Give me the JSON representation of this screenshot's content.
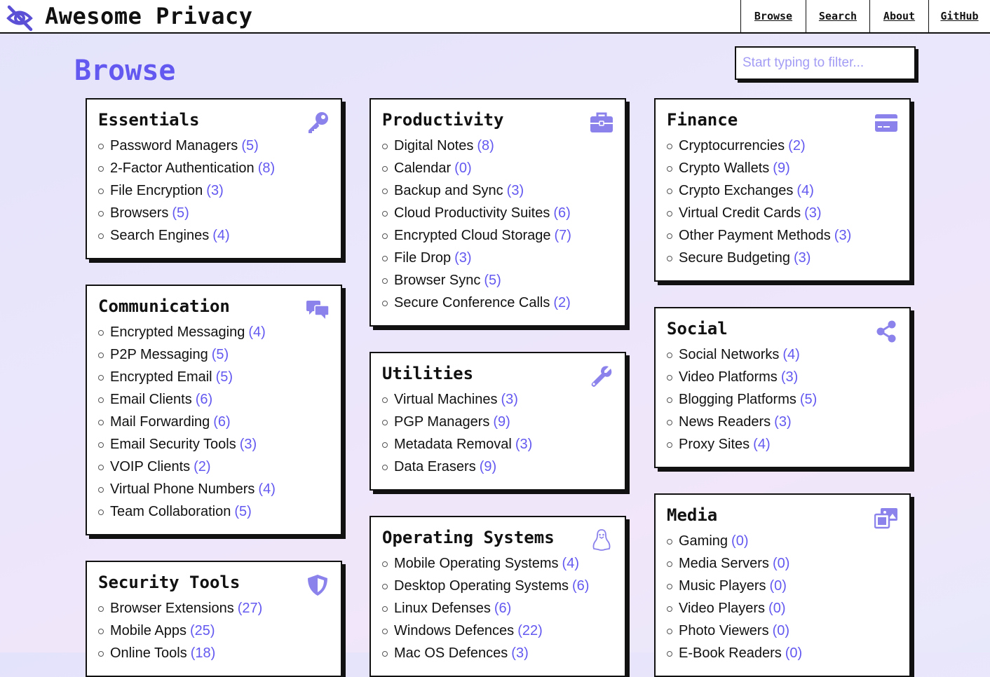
{
  "header": {
    "title": "Awesome Privacy",
    "nav": [
      "Browse",
      "Search",
      "About",
      "GitHub"
    ]
  },
  "page": {
    "title": "Browse",
    "filter_placeholder": "Start typing to filter..."
  },
  "colors": {
    "accent": "#6358f0",
    "icon": "#8b82ec",
    "border": "#111111"
  },
  "categories": [
    {
      "title": "Essentials",
      "icon": "key-icon",
      "items": [
        {
          "name": "Password Managers",
          "count": "(5)"
        },
        {
          "name": "2-Factor Authentication",
          "count": "(8)"
        },
        {
          "name": "File Encryption",
          "count": "(3)"
        },
        {
          "name": "Browsers",
          "count": "(5)"
        },
        {
          "name": "Search Engines",
          "count": "(4)"
        }
      ]
    },
    {
      "title": "Communication",
      "icon": "chat-bubbles-icon",
      "items": [
        {
          "name": "Encrypted Messaging",
          "count": "(4)"
        },
        {
          "name": "P2P Messaging",
          "count": "(5)"
        },
        {
          "name": "Encrypted Email",
          "count": "(5)"
        },
        {
          "name": "Email Clients",
          "count": "(6)"
        },
        {
          "name": "Mail Forwarding",
          "count": "(6)"
        },
        {
          "name": "Email Security Tools",
          "count": "(3)"
        },
        {
          "name": "VOIP Clients",
          "count": "(2)"
        },
        {
          "name": "Virtual Phone Numbers",
          "count": "(4)"
        },
        {
          "name": "Team Collaboration",
          "count": "(5)"
        }
      ]
    },
    {
      "title": "Security Tools",
      "icon": "shield-icon",
      "items": [
        {
          "name": "Browser Extensions",
          "count": "(27)"
        },
        {
          "name": "Mobile Apps",
          "count": "(25)"
        },
        {
          "name": "Online Tools",
          "count": "(18)"
        }
      ]
    },
    {
      "title": "Productivity",
      "icon": "briefcase-icon",
      "items": [
        {
          "name": "Digital Notes",
          "count": "(8)"
        },
        {
          "name": "Calendar",
          "count": "(0)"
        },
        {
          "name": "Backup and Sync",
          "count": "(3)"
        },
        {
          "name": "Cloud Productivity Suites",
          "count": "(6)"
        },
        {
          "name": "Encrypted Cloud Storage",
          "count": "(7)"
        },
        {
          "name": "File Drop",
          "count": "(3)"
        },
        {
          "name": "Browser Sync",
          "count": "(5)"
        },
        {
          "name": "Secure Conference Calls",
          "count": "(2)"
        }
      ]
    },
    {
      "title": "Utilities",
      "icon": "wrench-icon",
      "items": [
        {
          "name": "Virtual Machines",
          "count": "(3)"
        },
        {
          "name": "PGP Managers",
          "count": "(9)"
        },
        {
          "name": "Metadata Removal",
          "count": "(3)"
        },
        {
          "name": "Data Erasers",
          "count": "(9)"
        }
      ]
    },
    {
      "title": "Operating Systems",
      "icon": "linux-penguin-icon",
      "items": [
        {
          "name": "Mobile Operating Systems",
          "count": "(4)"
        },
        {
          "name": "Desktop Operating Systems",
          "count": "(6)"
        },
        {
          "name": "Linux Defenses",
          "count": "(6)"
        },
        {
          "name": "Windows Defences",
          "count": "(22)"
        },
        {
          "name": "Mac OS Defences",
          "count": "(3)"
        }
      ]
    },
    {
      "title": "Finance",
      "icon": "credit-card-icon",
      "items": [
        {
          "name": "Cryptocurrencies",
          "count": "(2)"
        },
        {
          "name": "Crypto Wallets",
          "count": "(9)"
        },
        {
          "name": "Crypto Exchanges",
          "count": "(4)"
        },
        {
          "name": "Virtual Credit Cards",
          "count": "(3)"
        },
        {
          "name": "Other Payment Methods",
          "count": "(3)"
        },
        {
          "name": "Secure Budgeting",
          "count": "(3)"
        }
      ]
    },
    {
      "title": "Social",
      "icon": "share-icon",
      "items": [
        {
          "name": "Social Networks",
          "count": "(4)"
        },
        {
          "name": "Video Platforms",
          "count": "(3)"
        },
        {
          "name": "Blogging Platforms",
          "count": "(5)"
        },
        {
          "name": "News Readers",
          "count": "(3)"
        },
        {
          "name": "Proxy Sites",
          "count": "(4)"
        }
      ]
    },
    {
      "title": "Media",
      "icon": "photo-video-icon",
      "items": [
        {
          "name": "Gaming",
          "count": "(0)"
        },
        {
          "name": "Media Servers",
          "count": "(0)"
        },
        {
          "name": "Music Players",
          "count": "(0)"
        },
        {
          "name": "Video Players",
          "count": "(0)"
        },
        {
          "name": "Photo Viewers",
          "count": "(0)"
        },
        {
          "name": "E-Book Readers",
          "count": "(0)"
        }
      ]
    }
  ]
}
